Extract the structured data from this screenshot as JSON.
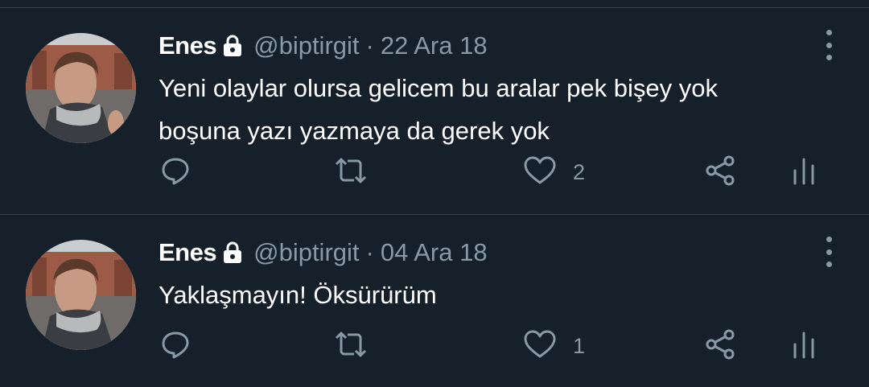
{
  "tweets": [
    {
      "name": "Enes",
      "handle": "@biptirgit",
      "separator": "·",
      "date": "22 Ara 18",
      "text": "Yeni olaylar olursa gelicem bu aralar pek bişey yok\nboşuna yazı yazmaya da gerek yok",
      "likes": "2",
      "icons": [
        "lock-icon",
        "more-icon",
        "reply-icon",
        "retweet-icon",
        "like-icon",
        "share-icon",
        "views-icon"
      ]
    },
    {
      "name": "Enes",
      "handle": "@biptirgit",
      "separator": "·",
      "date": "04 Ara 18",
      "text": "Yaklaşmayın! Öksürürüm",
      "likes": "1",
      "icons": [
        "lock-icon",
        "more-icon",
        "reply-icon",
        "retweet-icon",
        "like-icon",
        "share-icon",
        "views-icon"
      ]
    }
  ],
  "colors": {
    "background": "#15202b",
    "divider": "#38444d",
    "primary_text": "#ffffff",
    "secondary_text": "#8899a6"
  }
}
